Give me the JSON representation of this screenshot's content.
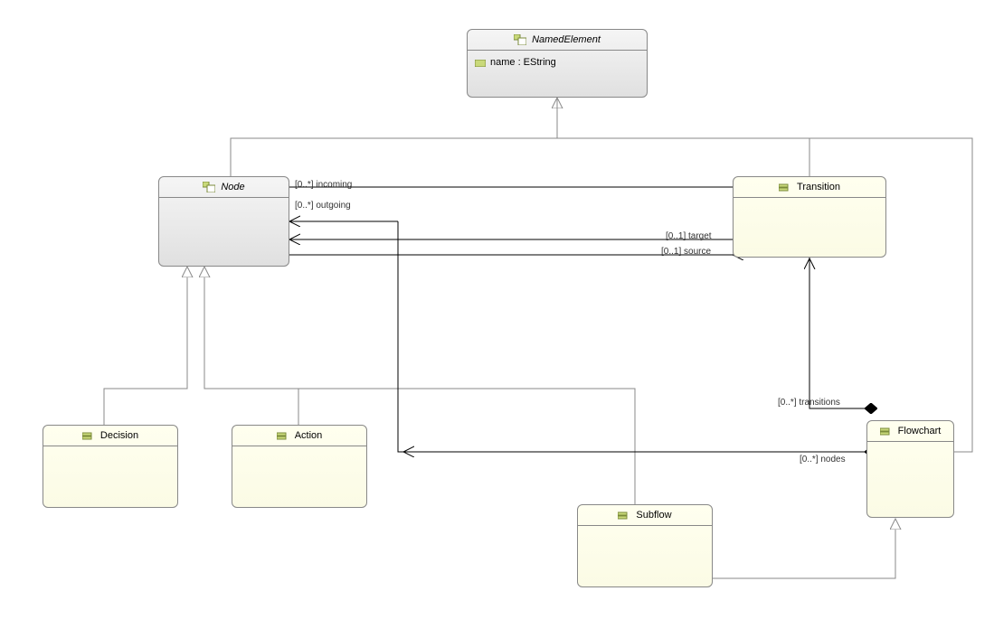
{
  "classes": {
    "namedElement": {
      "title": "NamedElement",
      "attr": "name : EString"
    },
    "node": {
      "title": "Node"
    },
    "transition": {
      "title": "Transition"
    },
    "decision": {
      "title": "Decision"
    },
    "action": {
      "title": "Action"
    },
    "subflow": {
      "title": "Subflow"
    },
    "flowchart": {
      "title": "Flowchart"
    }
  },
  "edges": {
    "incoming": "[0..*] incoming",
    "outgoing": "[0..*] outgoing",
    "target": "[0..1] target",
    "source": "[0..1] source",
    "transitions": "[0..*] transitions",
    "nodes": "[0..*] nodes"
  },
  "chart_data": {
    "type": "uml_class_diagram",
    "classes": [
      {
        "name": "NamedElement",
        "abstract": true,
        "attributes": [
          "name : EString"
        ]
      },
      {
        "name": "Node",
        "abstract": true,
        "attributes": []
      },
      {
        "name": "Transition",
        "abstract": false,
        "attributes": []
      },
      {
        "name": "Decision",
        "abstract": false,
        "attributes": []
      },
      {
        "name": "Action",
        "abstract": false,
        "attributes": []
      },
      {
        "name": "Subflow",
        "abstract": false,
        "attributes": []
      },
      {
        "name": "Flowchart",
        "abstract": false,
        "attributes": []
      }
    ],
    "generalizations": [
      {
        "child": "Node",
        "parent": "NamedElement"
      },
      {
        "child": "Transition",
        "parent": "NamedElement"
      },
      {
        "child": "Decision",
        "parent": "Node"
      },
      {
        "child": "Action",
        "parent": "Node"
      },
      {
        "child": "Subflow",
        "parent": "Node"
      },
      {
        "child": "Flowchart",
        "parent": "NamedElement"
      },
      {
        "child": "Subflow",
        "parent": "Flowchart"
      }
    ],
    "associations": [
      {
        "from": "Node",
        "to": "Transition",
        "label": "incoming",
        "mult": "0..*",
        "bidirectional": true
      },
      {
        "from": "Node",
        "to": "Transition",
        "label": "outgoing",
        "mult": "0..*",
        "bidirectional": false
      },
      {
        "from": "Transition",
        "to": "Node",
        "label": "target",
        "mult": "0..1",
        "bidirectional": false
      },
      {
        "from": "Transition",
        "to": "Node",
        "label": "source",
        "mult": "0..1",
        "bidirectional": true
      },
      {
        "from": "Flowchart",
        "to": "Transition",
        "label": "transitions",
        "mult": "0..*",
        "composition": true
      },
      {
        "from": "Flowchart",
        "to": "Node",
        "label": "nodes",
        "mult": "0..*",
        "composition": true
      }
    ]
  }
}
